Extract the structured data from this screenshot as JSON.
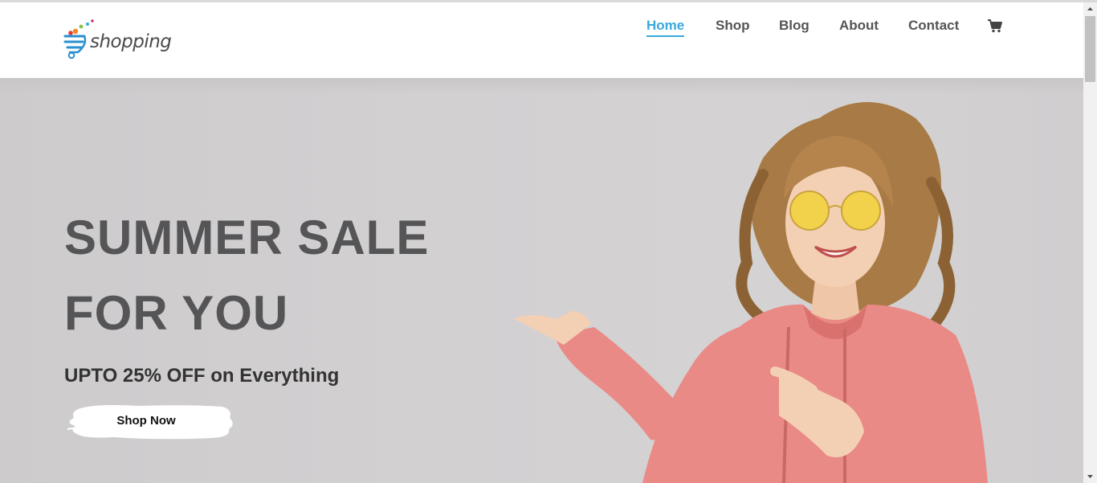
{
  "brand": {
    "logo_text": "shopping"
  },
  "nav": {
    "items": [
      {
        "label": "Home",
        "active": true
      },
      {
        "label": "Shop",
        "active": false
      },
      {
        "label": "Blog",
        "active": false
      },
      {
        "label": "About",
        "active": false
      },
      {
        "label": "Contact",
        "active": false
      }
    ],
    "cart_icon": "shopping-cart-icon"
  },
  "hero": {
    "title_line1": "SUMMER SALE",
    "title_line2": "FOR YOU",
    "subtitle": "UPTO 25% OFF on Everything",
    "cta_label": "Shop Now"
  },
  "colors": {
    "accent": "#3aa8dc",
    "nav_text": "#555555",
    "hero_bg": "#d2d0d1",
    "title_text": "#555457"
  }
}
